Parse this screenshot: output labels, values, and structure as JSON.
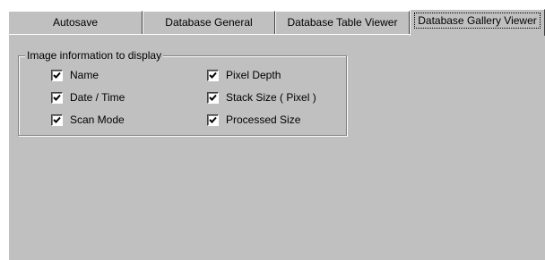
{
  "tabs": [
    {
      "label": "Autosave",
      "active": false
    },
    {
      "label": "Database General",
      "active": false
    },
    {
      "label": "Database Table Viewer",
      "active": false
    },
    {
      "label": "Database Gallery Viewer",
      "active": true
    }
  ],
  "group": {
    "title": "Image information to display",
    "left_column": [
      {
        "label": "Name",
        "checked": true
      },
      {
        "label": "Date / Time",
        "checked": true
      },
      {
        "label": "Scan Mode",
        "checked": true
      }
    ],
    "right_column": [
      {
        "label": "Pixel Depth",
        "checked": true
      },
      {
        "label": "Stack Size ( Pixel )",
        "checked": true
      },
      {
        "label": "Processed Size",
        "checked": true
      }
    ]
  },
  "colors": {
    "face": "#c0c0c0",
    "highlight": "#ffffff",
    "shadow": "#808080",
    "dark_shadow": "#404040"
  },
  "icons": {
    "checkmark": "checkmark-icon"
  }
}
